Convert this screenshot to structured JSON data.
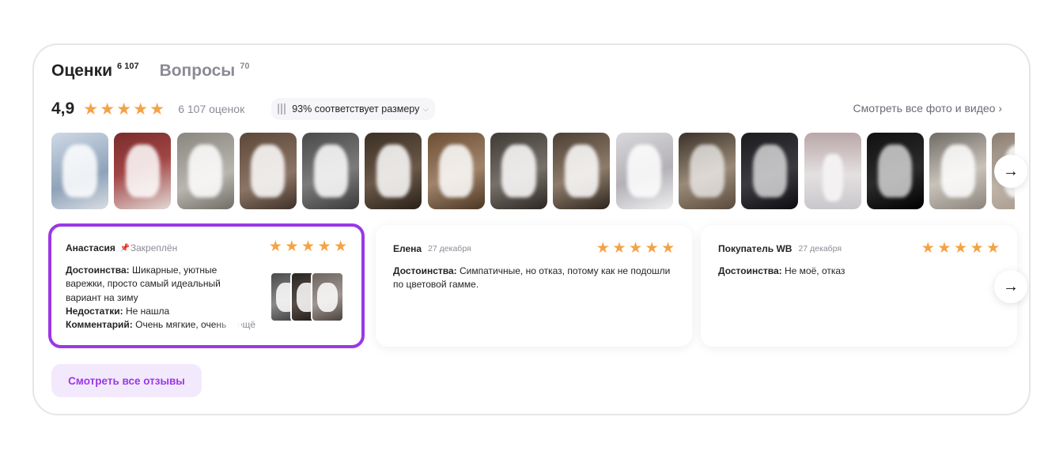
{
  "tabs": [
    {
      "label": "Оценки",
      "count": "6 107",
      "active": true
    },
    {
      "label": "Вопросы",
      "count": "70",
      "active": false
    }
  ],
  "rating": {
    "value": "4,9",
    "stars": 5,
    "count_text": "6 107 оценок",
    "fit_badge": "93% соответствует размеру",
    "see_all_media": "Смотреть все фото и видео"
  },
  "icons": {
    "star": "star-icon",
    "arrow_right": "arrow-right-icon",
    "chevron": "chevron-right-icon",
    "chevron_down": "chevron-down-icon",
    "pin": "pin-icon",
    "ruler": "ruler-icon"
  },
  "colors": {
    "accent": "#9a38e5",
    "accent_bg": "#f3e9fd",
    "star": "#f5a246",
    "muted": "#8b8b95"
  },
  "thumbnails": [
    {
      "bg": "linear-gradient(160deg,#cfd9e6,#8ea2b9 60%,#d9dde3)"
    },
    {
      "bg": "linear-gradient(160deg,#7a2b2b,#a14545 45%,#e2d9d5)"
    },
    {
      "bg": "linear-gradient(160deg,#8a8780,#b8b5ae 60%,#6f6c66)"
    },
    {
      "bg": "linear-gradient(160deg,#5c4738,#8b7465 60%,#3f3028)"
    },
    {
      "bg": "linear-gradient(160deg,#4a4a4a,#7b7b7b 55%,#3a3a3a)"
    },
    {
      "bg": "linear-gradient(160deg,#3b2f24,#6a5848 55%,#2a2119)"
    },
    {
      "bg": "linear-gradient(160deg,#6d4f34,#a0836a 55%,#4b3623)"
    },
    {
      "bg": "linear-gradient(160deg,#3f3a35,#77706a 55%,#2b2622)"
    },
    {
      "bg": "linear-gradient(160deg,#4c3f34,#8e7c6a 55%,#2e251e)"
    },
    {
      "bg": "linear-gradient(160deg,#d9d8dc,#b3b1b6 55%,#f0eff1)"
    },
    {
      "bg": "linear-gradient(160deg,#3a3128,#9a8a78 55%,#5a4a3c)",
      "dark": true
    },
    {
      "bg": "linear-gradient(160deg,#1c1c1f,#3a3a40 55%,#0d0d10)",
      "dark": true
    },
    {
      "bg": "linear-gradient(180deg,#b9a7a8,#e4e0e1 55%,#c9c7cc)",
      "person": true
    },
    {
      "bg": "linear-gradient(160deg,#111,#2a2a2a 55%,#000)",
      "dark": true
    },
    {
      "bg": "linear-gradient(160deg,#6f6a64,#c8c2ba 55%,#8a847c)"
    },
    {
      "bg": "linear-gradient(160deg,#8a7c70,#c2b6aa 55%,#a29689)"
    }
  ],
  "reviews": [
    {
      "author": "Анастасия",
      "pinned_label": "Закреплён",
      "date": "",
      "stars": 5,
      "pros_label": "Достоинства:",
      "pros": "Шикарные, уютные варежки, просто самый идеальный вариант на зиму",
      "cons_label": "Недостатки:",
      "cons": "Не нашла",
      "comment_label": "Комментарий:",
      "comment": "Очень мягкие, очень",
      "more": "ещё",
      "selected": true
    },
    {
      "author": "Елена",
      "date": "27 декабря",
      "stars": 5,
      "pros_label": "Достоинства:",
      "pros": "Симпатичные, но отказ, потому как не подошли по цветовой гамме."
    },
    {
      "author": "Покупатель WB",
      "date": "27 декабря",
      "stars": 5,
      "pros_label": "Достоинства:",
      "pros": "Не моё, отказ"
    }
  ],
  "all_reviews_button": "Смотреть все отзывы"
}
